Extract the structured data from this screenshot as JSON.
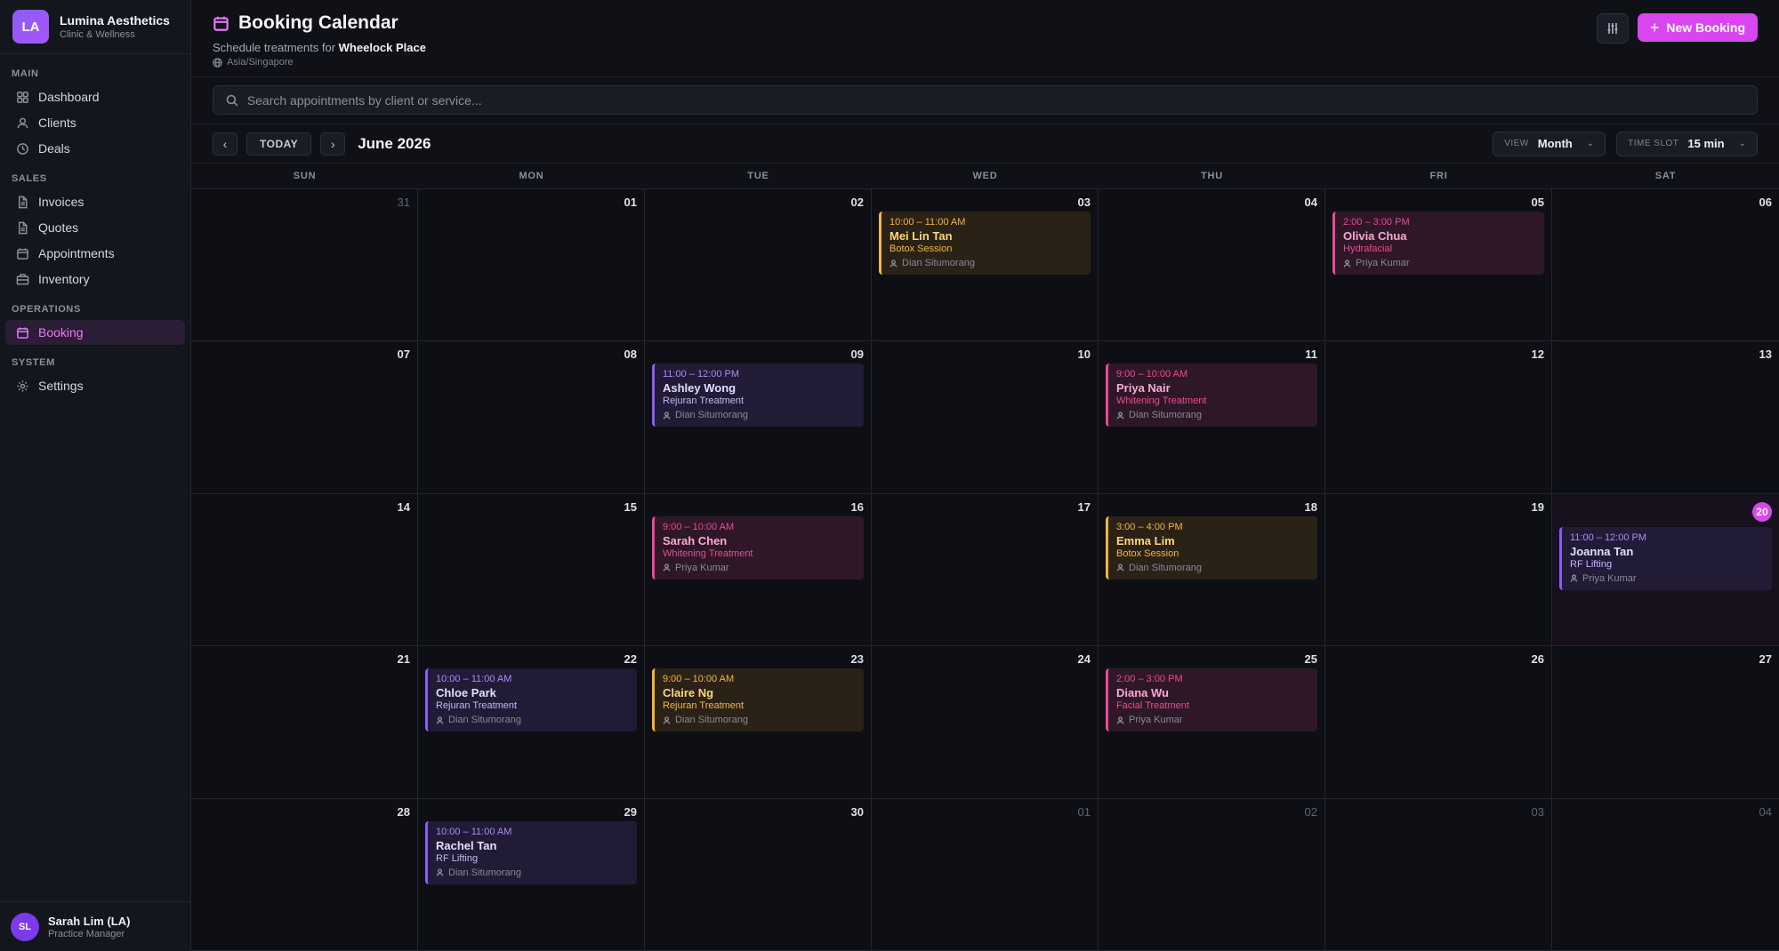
{
  "brand": {
    "initials": "LA",
    "name": "Lumina Aesthetics",
    "subtitle": "Clinic & Wellness"
  },
  "sidebar": {
    "sections": [
      {
        "label": "MAIN",
        "items": [
          {
            "label": "Dashboard",
            "icon": "dashboard-icon"
          },
          {
            "label": "Clients",
            "icon": "user-icon"
          },
          {
            "label": "Deals",
            "icon": "clock-icon"
          }
        ]
      },
      {
        "label": "SALES",
        "items": [
          {
            "label": "Invoices",
            "icon": "document-icon"
          },
          {
            "label": "Quotes",
            "icon": "document-icon"
          },
          {
            "label": "Appointments",
            "icon": "calendar-icon"
          },
          {
            "label": "Inventory",
            "icon": "box-icon"
          }
        ]
      },
      {
        "label": "OPERATIONS",
        "items": [
          {
            "label": "Booking",
            "icon": "calendar-icon",
            "active": true
          }
        ]
      },
      {
        "label": "SYSTEM",
        "items": [
          {
            "label": "Settings",
            "icon": "gear-icon"
          }
        ]
      }
    ]
  },
  "user": {
    "initials": "SL",
    "name": "Sarah Lim (LA)",
    "role": "Practice Manager"
  },
  "header": {
    "title": "Booking Calendar",
    "subtitle_prefix": "Schedule treatments for",
    "location": "Wheelock Place",
    "timezone": "Asia/Singapore",
    "new_booking_label": "New Booking"
  },
  "search": {
    "placeholder": "Search appointments by client or service..."
  },
  "toolbar": {
    "prev": "‹",
    "today_label": "TODAY",
    "next": "›",
    "month_label": "June 2026",
    "view_label": "VIEW",
    "view_value": "Month",
    "slot_label": "TIME SLOT",
    "slot_value": "15 min"
  },
  "weekdays": [
    "SUN",
    "MON",
    "TUE",
    "WED",
    "THU",
    "FRI",
    "SAT"
  ],
  "colors": {
    "accent": "#d946ef",
    "amber": "#f5b53f",
    "pink": "#ec4899",
    "purple": "#8b5cf6"
  },
  "calendar": [
    {
      "day": "31",
      "outside": true
    },
    {
      "day": "01"
    },
    {
      "day": "02"
    },
    {
      "day": "03",
      "event": {
        "time": "10:00 – 11:00 AM",
        "client": "Mei Lin Tan",
        "service": "Botox Session",
        "staff": "Dian Situmorang",
        "color": "amber"
      }
    },
    {
      "day": "04"
    },
    {
      "day": "05",
      "event": {
        "time": "2:00 – 3:00 PM",
        "client": "Olivia Chua",
        "service": "Hydrafacial",
        "staff": "Priya Kumar",
        "color": "pink"
      }
    },
    {
      "day": "06"
    },
    {
      "day": "07"
    },
    {
      "day": "08"
    },
    {
      "day": "09",
      "event": {
        "time": "11:00 – 12:00 PM",
        "client": "Ashley Wong",
        "service": "Rejuran Treatment",
        "staff": "Dian Situmorang",
        "color": "purple"
      }
    },
    {
      "day": "10"
    },
    {
      "day": "11",
      "event": {
        "time": "9:00 – 10:00 AM",
        "client": "Priya Nair",
        "service": "Whitening Treatment",
        "staff": "Dian Situmorang",
        "color": "pink"
      }
    },
    {
      "day": "12"
    },
    {
      "day": "13"
    },
    {
      "day": "14"
    },
    {
      "day": "15"
    },
    {
      "day": "16",
      "event": {
        "time": "9:00 – 10:00 AM",
        "client": "Sarah Chen",
        "service": "Whitening Treatment",
        "staff": "Priya Kumar",
        "color": "pink"
      }
    },
    {
      "day": "17"
    },
    {
      "day": "18",
      "event": {
        "time": "3:00 – 4:00 PM",
        "client": "Emma Lim",
        "service": "Botox Session",
        "staff": "Dian Situmorang",
        "color": "amber"
      }
    },
    {
      "day": "19"
    },
    {
      "day": "20",
      "today": true,
      "event": {
        "time": "11:00 – 12:00 PM",
        "client": "Joanna Tan",
        "service": "RF Lifting",
        "staff": "Priya Kumar",
        "color": "purple"
      }
    },
    {
      "day": "21"
    },
    {
      "day": "22",
      "event": {
        "time": "10:00 – 11:00 AM",
        "client": "Chloe Park",
        "service": "Rejuran Treatment",
        "staff": "Dian Situmorang",
        "color": "purple"
      }
    },
    {
      "day": "23",
      "event": {
        "time": "9:00 – 10:00 AM",
        "client": "Claire Ng",
        "service": "Rejuran Treatment",
        "staff": "Dian Situmorang",
        "color": "amber"
      }
    },
    {
      "day": "24"
    },
    {
      "day": "25",
      "event": {
        "time": "2:00 – 3:00 PM",
        "client": "Diana Wu",
        "service": "Facial Treatment",
        "staff": "Priya Kumar",
        "color": "pink"
      }
    },
    {
      "day": "26"
    },
    {
      "day": "27"
    },
    {
      "day": "28"
    },
    {
      "day": "29",
      "event": {
        "time": "10:00 – 11:00 AM",
        "client": "Rachel Tan",
        "service": "RF Lifting",
        "staff": "Dian Situmorang",
        "color": "purple"
      }
    },
    {
      "day": "30"
    },
    {
      "day": "01",
      "outside": true
    },
    {
      "day": "02",
      "outside": true
    },
    {
      "day": "03",
      "outside": true
    },
    {
      "day": "04",
      "outside": true
    }
  ]
}
